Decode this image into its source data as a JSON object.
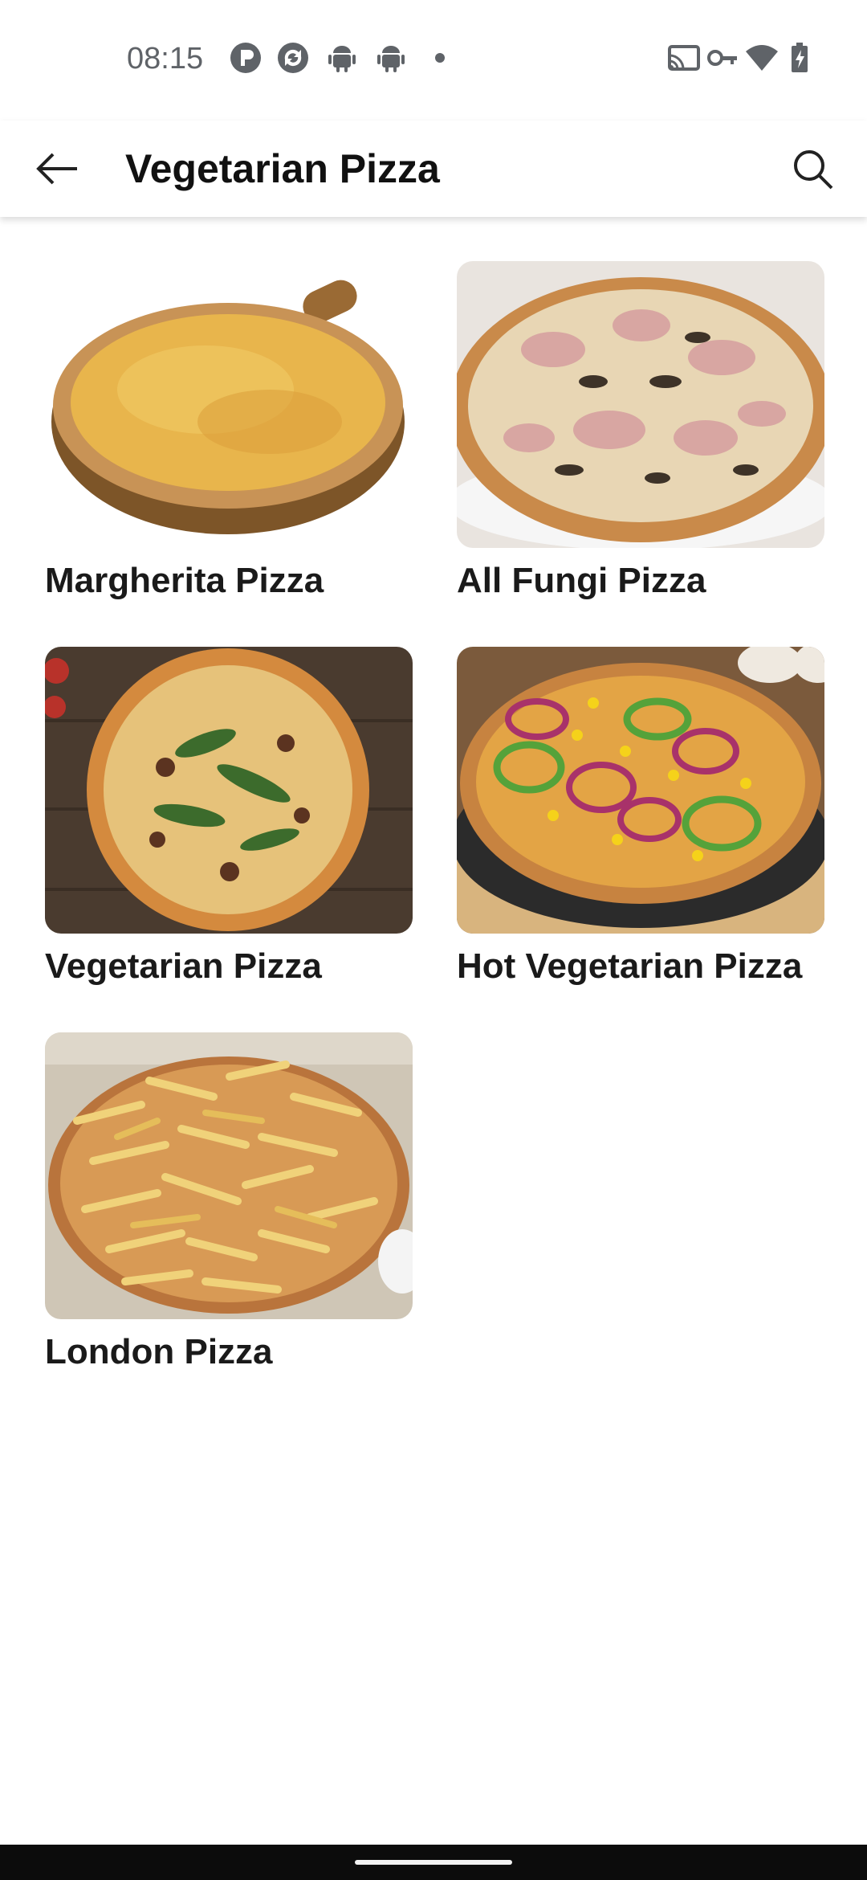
{
  "status_bar": {
    "time": "08:15",
    "left_icons": [
      "p-app-icon",
      "sync-app-icon",
      "android-icon",
      "android-icon",
      "dot-icon"
    ],
    "right_icons": [
      "cast-icon",
      "vpn-key-icon",
      "wifi-icon",
      "battery-charging-icon"
    ]
  },
  "app_bar": {
    "title": "Vegetarian Pizza",
    "back_icon": "arrow-left-icon",
    "search_icon": "search-icon"
  },
  "items": [
    {
      "label": "Margherita Pizza",
      "image": "margherita-pizza-photo"
    },
    {
      "label": "All Fungi Pizza",
      "image": "fungi-pizza-photo"
    },
    {
      "label": "Vegetarian Pizza",
      "image": "vegetarian-pizza-photo"
    },
    {
      "label": "Hot Vegetarian Pizza",
      "image": "hot-vegetarian-pizza-photo"
    },
    {
      "label": "London Pizza",
      "image": "london-pizza-photo"
    }
  ],
  "colors": {
    "background": "#ffffff",
    "title_text": "#111111",
    "status_text": "#5f6368",
    "nav_bar": "#0c0c0c"
  }
}
